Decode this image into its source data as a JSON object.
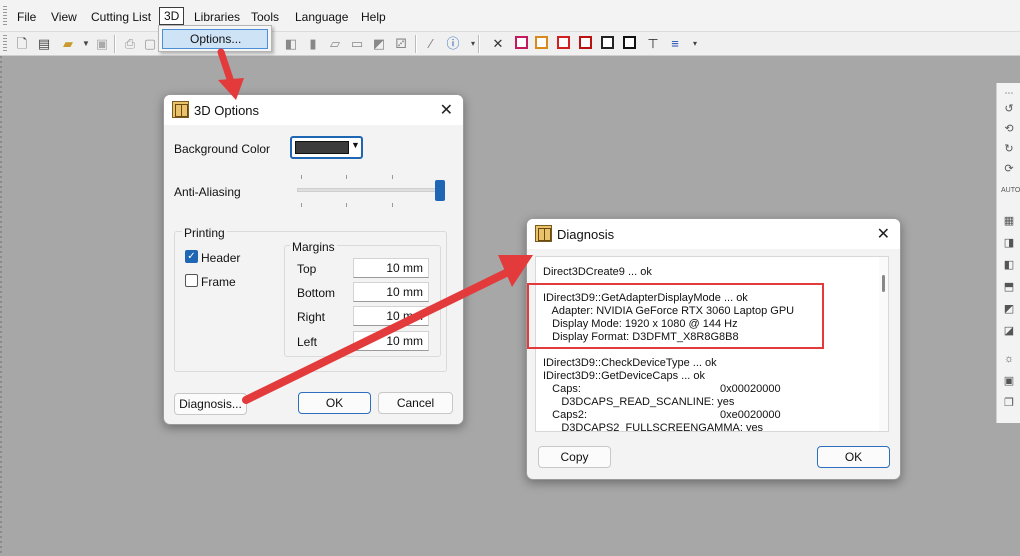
{
  "menubar": {
    "items": [
      "File",
      "View",
      "Cutting List",
      "3D",
      "Libraries",
      "Tools",
      "Language",
      "Help"
    ],
    "dropdown_item": "Options..."
  },
  "options_dialog": {
    "title": "3D Options",
    "background_color_label": "Background Color",
    "background_color": "#3b3b3b",
    "antialiasing_label": "Anti-Aliasing",
    "antialiasing_level": 1.0,
    "printing_label": "Printing",
    "header_label": "Header",
    "header_checked": true,
    "frame_label": "Frame",
    "frame_checked": false,
    "margins_label": "Margins",
    "margins": [
      {
        "label": "Top",
        "value": "10 mm"
      },
      {
        "label": "Bottom",
        "value": "10 mm"
      },
      {
        "label": "Right",
        "value": "10 mm"
      },
      {
        "label": "Left",
        "value": "10 mm"
      }
    ],
    "diagnosis_button": "Diagnosis...",
    "ok_button": "OK",
    "cancel_button": "Cancel"
  },
  "diagnosis_dialog": {
    "title": "Diagnosis",
    "lines": [
      "Direct3DCreate9 ... ok",
      "IDirect3D9::GetAdapterDisplayMode ... ok",
      "   Adapter: NVIDIA GeForce RTX 3060 Laptop GPU",
      "   Display Mode: 1920 x 1080 @ 144 Hz",
      "   Display Format: D3DFMT_X8R8G8B8",
      "IDirect3D9::CheckDeviceType ... ok",
      "IDirect3D9::GetDeviceCaps ... ok",
      "   Caps:",
      "      D3DCAPS_READ_SCANLINE: yes",
      "   Caps2:",
      "      D3DCAPS2_FULLSCREENGAMMA: yes"
    ],
    "caps_value": "0x00020000",
    "caps2_value": "0xe0020000",
    "copy_button": "Copy",
    "ok_button": "OK"
  },
  "colors": {
    "annotation_red": "#e33b3b",
    "accent_blue": "#1f67b5"
  }
}
